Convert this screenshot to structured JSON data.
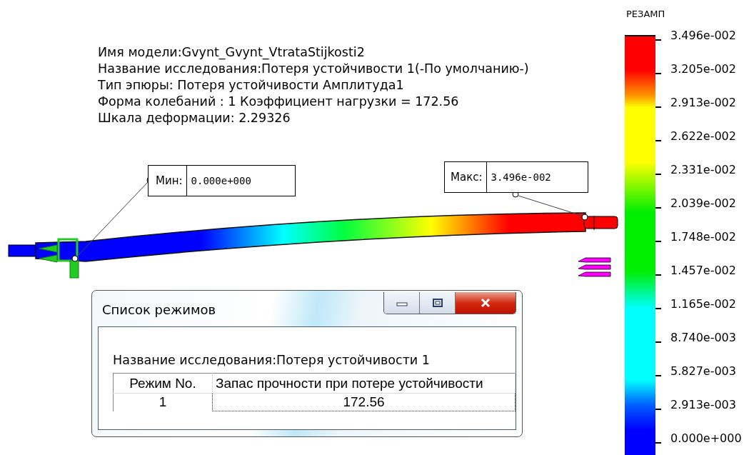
{
  "info_lines": [
    "Имя модели:Gvynt_Gvynt_VtrataStijkosti2",
    "Название исследования:Потеря устойчивости 1(-По умолчанию-)",
    "Тип эпюры: Потеря устойчивости Амплитуда1",
    "Форма колебаний : 1  Коэффициент нагрузки = 172.56",
    "Шкала деформации: 2.29326"
  ],
  "probes": [
    {
      "kind": "min",
      "label": "Мин:",
      "value": "0.000e+000"
    },
    {
      "kind": "max",
      "label": "Макс:",
      "value": "3.496e-002"
    }
  ],
  "legend": {
    "title": "РЕЗАМП",
    "labels": [
      "3.496e-002",
      "3.205e-002",
      "2.913e-002",
      "2.622e-002",
      "2.331e-002",
      "2.039e-002",
      "1.748e-002",
      "1.457e-002",
      "1.165e-002",
      "8.740e-003",
      "5.827e-003",
      "2.913e-003",
      "0.000e+000"
    ]
  },
  "dialog": {
    "title": "Список режимов",
    "buttons": [
      {
        "kind": "minimize"
      },
      {
        "kind": "maximize"
      },
      {
        "kind": "close"
      }
    ],
    "study": "Название исследования:Потеря устойчивости 1",
    "columns": [
      "Режим No.",
      "Запас прочности при потере устойчивости"
    ],
    "rows": [
      {
        "cells": [
          "1",
          "172.56"
        ],
        "selected": true
      }
    ]
  }
}
